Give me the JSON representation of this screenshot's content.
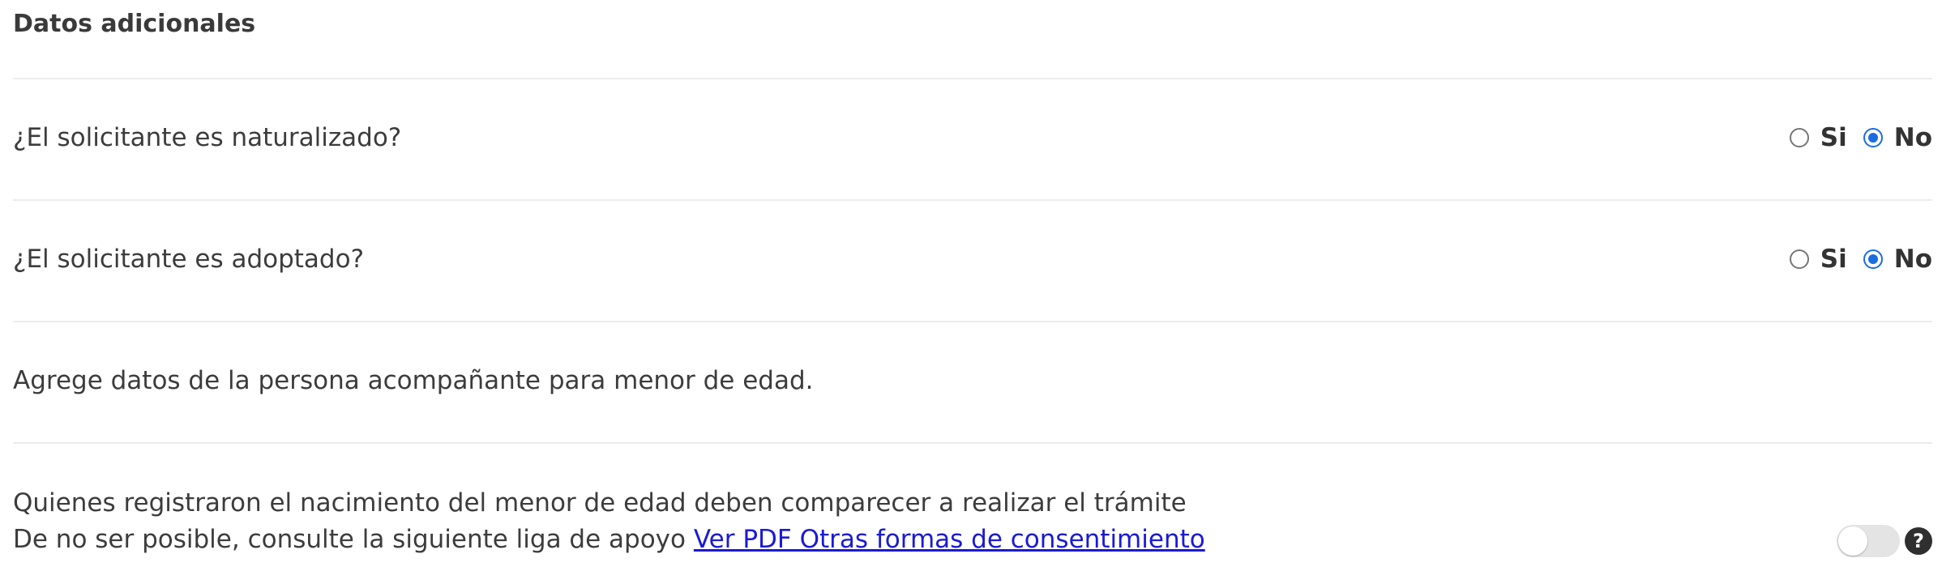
{
  "section": {
    "title": "Datos adicionales"
  },
  "questions": [
    {
      "label": "¿El solicitante es naturalizado?",
      "options": [
        "Si",
        "No"
      ],
      "selected": "No"
    },
    {
      "label": "¿El solicitante es adoptado?",
      "options": [
        "Si",
        "No"
      ],
      "selected": "No"
    }
  ],
  "companion": {
    "text": "Agrege datos de la persona acompañante para menor de edad."
  },
  "notice": {
    "line1": "Quienes registraron el nacimiento del menor de edad deben comparecer a realizar el trámite",
    "line2_prefix": "De no ser posible, consulte la siguiente liga de apoyo",
    "link_text": "Ver PDF Otras formas de consentimiento"
  },
  "toggle": {
    "on": false
  },
  "icons": {
    "help": "question-circle-icon",
    "help_glyph": "?"
  },
  "colors": {
    "accent": "#1a6de0",
    "link": "#1a1ad6",
    "divider": "#ececec",
    "text": "#3c3c3c"
  }
}
